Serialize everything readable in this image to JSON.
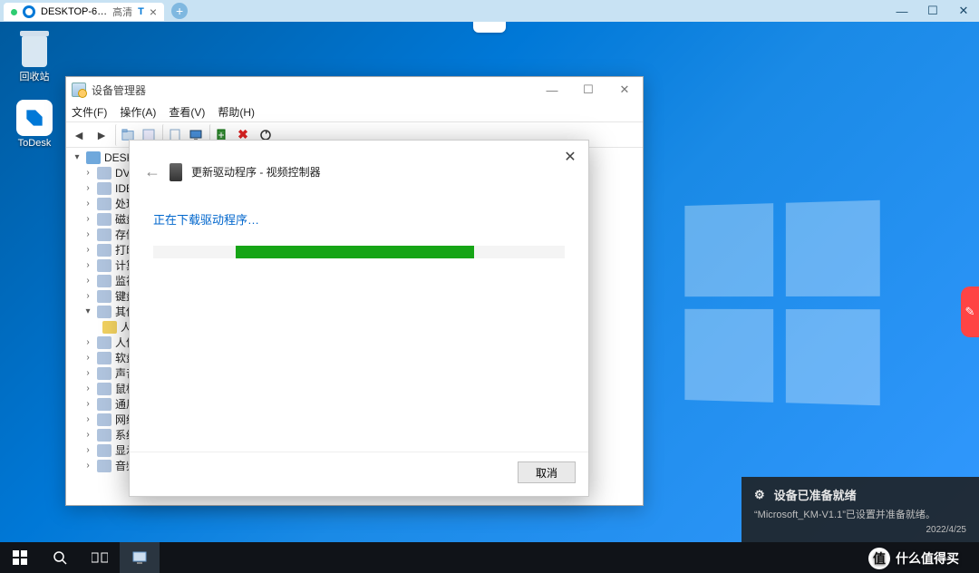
{
  "remote": {
    "tab_name": "DESKTOP-6…",
    "quality": "高清",
    "letter": "T",
    "close_glyph": "×",
    "add_glyph": "+",
    "min": "—",
    "max": "☐",
    "close": "✕"
  },
  "desktop_icons": {
    "recycle_bin": "回收站",
    "todesk": "ToDesk"
  },
  "device_manager": {
    "title": "设备管理器",
    "menu": {
      "file": "文件(F)",
      "action": "操作(A)",
      "view": "查看(V)",
      "help": "帮助(H)"
    },
    "toolbar_names": [
      "back",
      "forward",
      "up",
      "show-hidden",
      "properties",
      "monitor",
      "scan",
      "delete",
      "update"
    ],
    "win_btns": {
      "min": "—",
      "max": "☐",
      "close": "✕"
    },
    "tree": {
      "root": "DESKT",
      "items": [
        "DV",
        "IDE",
        "处理",
        "磁盘",
        "存储",
        "打印",
        "计算",
        "监视",
        "键盘"
      ],
      "other_root": "其他",
      "sub_item": "人机",
      "rest": [
        "人体",
        "软盘",
        "声音",
        "鼠标",
        "通用",
        "网络",
        "系统",
        "显示",
        "音频"
      ]
    }
  },
  "driver_dialog": {
    "title": "更新驱动程序 - 视频控制器",
    "status": "正在下载驱动程序…",
    "cancel": "取消",
    "progress_percent": 58
  },
  "notification": {
    "title": "设备已准备就绪",
    "body": "“Microsoft_KM-V1.1”已设置并准备就绪。",
    "date": "2022/4/25"
  },
  "watermark": {
    "badge": "值",
    "text": "什么值得买"
  }
}
